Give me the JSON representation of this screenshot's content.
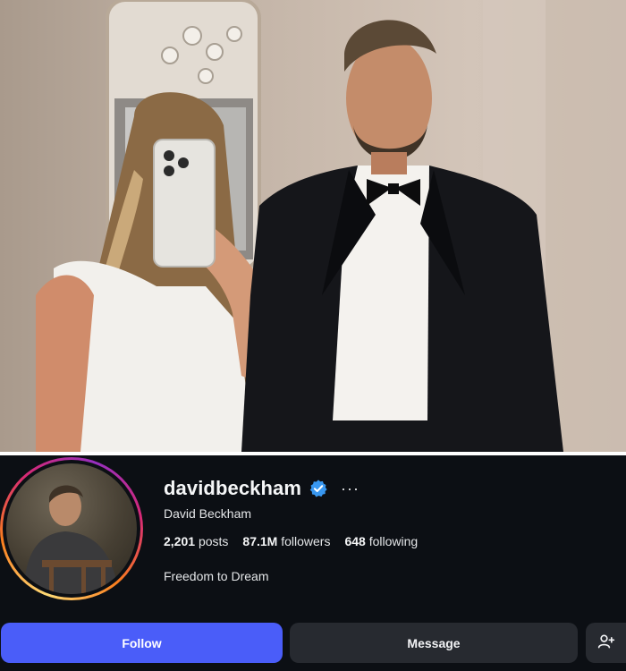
{
  "profile": {
    "username": "davidbeckham",
    "full_name": "David Beckham",
    "more_label": "···",
    "posts_count": "2,201",
    "posts_label": "posts",
    "followers_count": "87.1M",
    "followers_label": "followers",
    "following_count": "648",
    "following_label": "following",
    "bio": "Freedom to Dream",
    "verified": true
  },
  "actions": {
    "follow_label": "Follow",
    "message_label": "Message",
    "add_user_icon": "person-add-icon"
  },
  "colors": {
    "background": "#0c0f14",
    "follow_button": "#4a5df9",
    "secondary_button": "#272a30",
    "verified_badge": "#3897f0"
  }
}
